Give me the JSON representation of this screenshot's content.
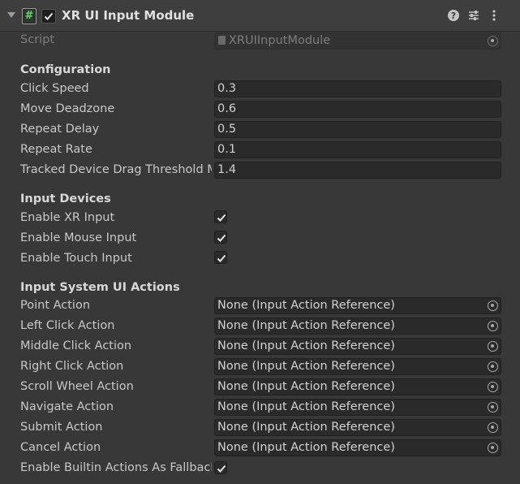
{
  "component": {
    "title": "XR UI Input Module",
    "enabled": true
  },
  "script": {
    "label": "Script",
    "value": "XRUIInputModule"
  },
  "configuration": {
    "heading": "Configuration",
    "fields": [
      {
        "label": "Click Speed",
        "value": "0.3"
      },
      {
        "label": "Move Deadzone",
        "value": "0.6"
      },
      {
        "label": "Repeat Delay",
        "value": "0.5"
      },
      {
        "label": "Repeat Rate",
        "value": "0.1"
      },
      {
        "label": "Tracked Device Drag Threshold Multiplier",
        "value": "1.4"
      }
    ]
  },
  "input_devices": {
    "heading": "Input Devices",
    "toggles": [
      {
        "label": "Enable XR Input",
        "checked": true
      },
      {
        "label": "Enable Mouse Input",
        "checked": true
      },
      {
        "label": "Enable Touch Input",
        "checked": true
      }
    ]
  },
  "actions": {
    "heading": "Input System UI Actions",
    "items": [
      {
        "label": "Point Action",
        "value": "None (Input Action Reference)"
      },
      {
        "label": "Left Click Action",
        "value": "None (Input Action Reference)"
      },
      {
        "label": "Middle Click Action",
        "value": "None (Input Action Reference)"
      },
      {
        "label": "Right Click Action",
        "value": "None (Input Action Reference)"
      },
      {
        "label": "Scroll Wheel Action",
        "value": "None (Input Action Reference)"
      },
      {
        "label": "Navigate Action",
        "value": "None (Input Action Reference)"
      },
      {
        "label": "Submit Action",
        "value": "None (Input Action Reference)"
      },
      {
        "label": "Cancel Action",
        "value": "None (Input Action Reference)"
      }
    ],
    "fallback": {
      "label": "Enable Builtin Actions As Fallback",
      "checked": true
    }
  },
  "icons": {
    "foldout": "foldout-arrow-icon",
    "script": "csharp-script-icon",
    "help": "help-icon",
    "presets": "presets-icon",
    "menu": "context-menu-icon",
    "picker": "object-picker-icon",
    "checkmark": "checkmark-icon"
  }
}
